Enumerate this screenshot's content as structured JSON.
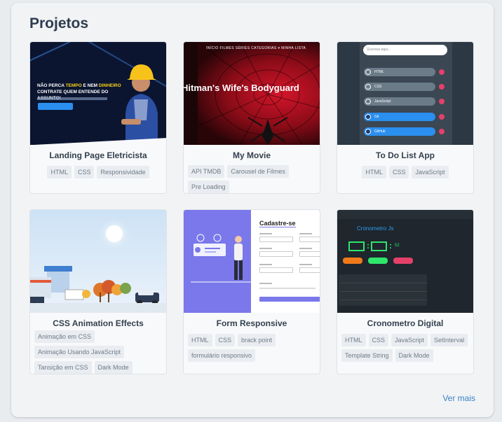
{
  "section": {
    "title": "Projetos"
  },
  "projects": [
    {
      "name": "Landing Page Eletricista",
      "tags": [
        "HTML",
        "CSS",
        "Responsividade"
      ],
      "thumb_text": {
        "line1a": "NÃO PERCA ",
        "line1b": "TEMPO",
        "line1c": " E NEM ",
        "line1d": "DINHEIRO",
        "line2": "CONTRATE QUEM ENTENDE DO ASSUNTO!"
      }
    },
    {
      "name": "My Movie",
      "tags": [
        "API TMDB",
        "Carousel de Filmes",
        "Pre Loading"
      ],
      "thumb_text": {
        "nav": "INÍCIO   FILMES   SÉRIES   CATEGORIAS ▾   MINHA LISTA",
        "title": "Hitman's Wife's Bodyguard"
      }
    },
    {
      "name": "To Do List App",
      "tags": [
        "HTML",
        "CSS",
        "JavaScript"
      ],
      "thumb_text": {
        "search": "Escreva aqui...",
        "items": [
          "HTML",
          "CSS",
          "JavaScript",
          "Git",
          "GitHub"
        ]
      }
    },
    {
      "name": "CSS Animation Effects",
      "tags": [
        "Animação em CSS",
        "Animação Usando JavaScript",
        "Tansição em CSS",
        "Dark Mode"
      ]
    },
    {
      "name": "Form Responsive",
      "tags": [
        "HTML",
        "CSS",
        "brack point",
        "formulário responsivo"
      ],
      "thumb_text": {
        "title": "Cadastre-se"
      }
    },
    {
      "name": "Cronometro Digital",
      "tags": [
        "HTML",
        "CSS",
        "JavaScript",
        "SetInterval",
        "Template String",
        "Dark Mode"
      ],
      "thumb_text": {
        "title": "Cronometro Js",
        "d1": "00",
        "d2": "01",
        "ms": "52"
      }
    }
  ],
  "footer": {
    "more_link": "Ver mais"
  },
  "colors": {
    "accent": "#3b82c4",
    "title": "#2e3c4f",
    "tag_bg": "#e9edf1"
  }
}
